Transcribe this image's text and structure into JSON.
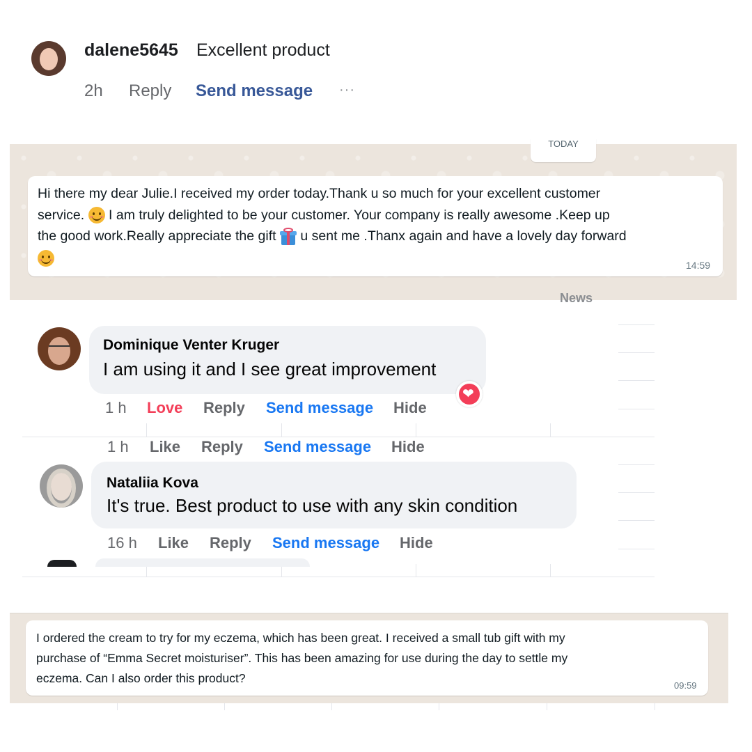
{
  "top_comment": {
    "username": "dalene5645",
    "text": "Excellent product",
    "time": "2h",
    "reply": "Reply",
    "send_message": "Send message",
    "more": "···"
  },
  "whatsapp_1": {
    "date_chip": "TODAY",
    "line1": "Hi there my dear Julie.I received my order today.Thank u so much for your excellent customer",
    "line2a": "service. ",
    "line2b": " I am truly delighted to be your customer. Your company  is really awesome .Keep up",
    "line3a": "the good work.Really appreciate the gift ",
    "line3b": " u sent me .Thanx again and have a lovely day forward",
    "time": "14:59"
  },
  "news_fragment": "News",
  "comment_dominique": {
    "name": "Dominique Venter Kruger",
    "text": "I am using it and I see great improvement",
    "time": "1 h",
    "love": "Love",
    "reply": "Reply",
    "send_message": "Send message",
    "hide": "Hide"
  },
  "meta_row_extra": {
    "time": "1 h",
    "like": "Like",
    "reply": "Reply",
    "send_message": "Send message",
    "hide": "Hide"
  },
  "comment_nataliia": {
    "name": "Nataliia Kova",
    "text": "It's true. Best product to use with any skin condition",
    "time": "16 h",
    "like": "Like",
    "reply": "Reply",
    "send_message": "Send message",
    "hide": "Hide"
  },
  "whatsapp_2": {
    "line1": "I ordered the cream to try for my eczema, which has been great. I received a small tub gift with my",
    "line2": "purchase of “Emma Secret moisturiser”. This has been amazing for use during the day to settle my",
    "line3": "eczema. Can I also order this product?",
    "time": "09:59"
  },
  "colors": {
    "fb_blue": "#1877f2",
    "love_red": "#f33e58",
    "whatsapp_bg": "#ece5dd"
  }
}
